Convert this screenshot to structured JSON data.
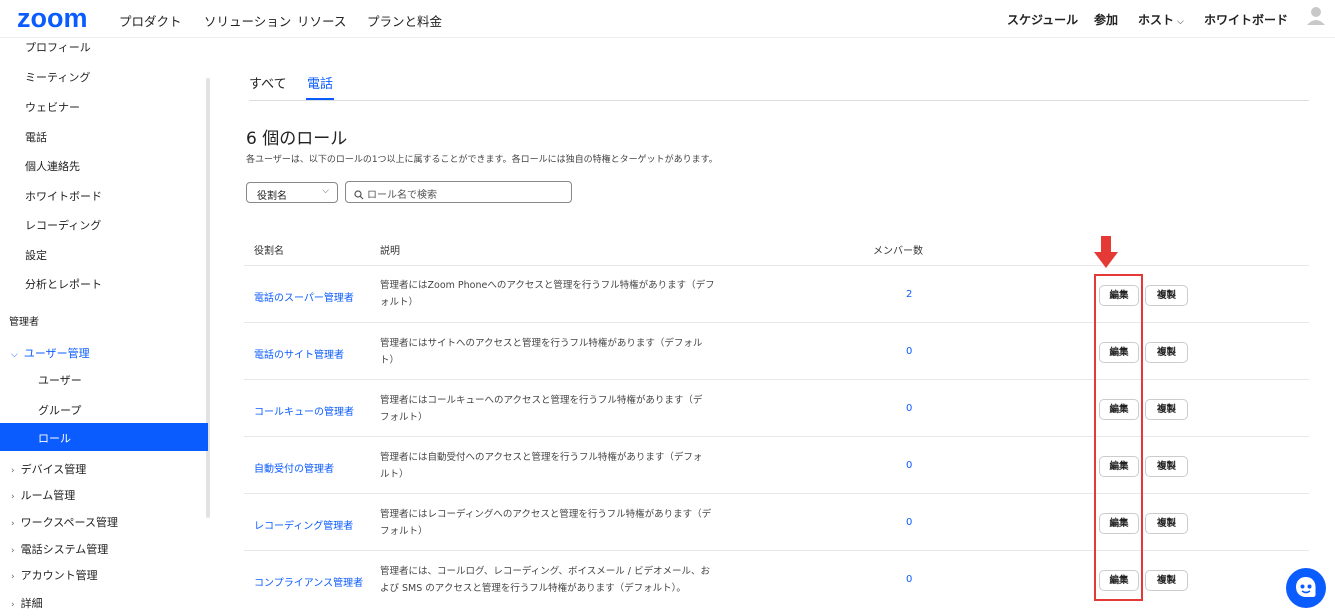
{
  "header": {
    "logo": "zoom",
    "nav": [
      "プロダクト",
      "ソリューション",
      "リソース",
      "プランと料金"
    ],
    "right": {
      "schedule": "スケジュール",
      "join": "参加",
      "host": "ホスト",
      "whiteboard": "ホワイトボード"
    }
  },
  "sidebar": {
    "items": [
      "プロフィール",
      "ミーティング",
      "ウェビナー",
      "電話",
      "個人連絡先",
      "ホワイトボード",
      "レコーディング",
      "設定",
      "分析とレポート"
    ],
    "admin_section": "管理者",
    "user_mgmt": {
      "label": "ユーザー管理",
      "children": [
        "ユーザー",
        "グループ",
        "ロール"
      ],
      "active": "ロール"
    },
    "groups": [
      "デバイス管理",
      "ルーム管理",
      "ワークスペース管理",
      "電話システム管理",
      "アカウント管理",
      "詳細"
    ]
  },
  "main": {
    "tabs": [
      {
        "label": "すべて",
        "active": false
      },
      {
        "label": "電話",
        "active": true
      }
    ],
    "title": "6 個のロール",
    "description": "各ユーザーは、以下のロールの1つ以上に属することができます。各ロールには独自の特権とターゲットがあります。",
    "filter": {
      "selected": "役割名",
      "search_placeholder": "ロール名で検索"
    },
    "columns": {
      "name": "役割名",
      "description": "説明",
      "members": "メンバー数"
    },
    "buttons": {
      "edit": "編集",
      "copy": "複製"
    },
    "roles": [
      {
        "name": "電話のスーパー管理者",
        "desc1": "管理者にはZoom Phoneへのアクセスと管理を行うフル特権があります（デフ",
        "desc2": "ォルト）",
        "members": "2"
      },
      {
        "name": "電話のサイト管理者",
        "desc1": "管理者にはサイトへのアクセスと管理を行うフル特権があります（デフォル",
        "desc2": "ト）",
        "members": "0"
      },
      {
        "name": "コールキューの管理者",
        "desc1": "管理者にはコールキューへのアクセスと管理を行うフル特権があります（デ",
        "desc2": "フォルト）",
        "members": "0"
      },
      {
        "name": "自動受付の管理者",
        "desc1": "管理者には自動受付へのアクセスと管理を行うフル特権があります（デフォ",
        "desc2": "ルト）",
        "members": "0"
      },
      {
        "name": "レコーディング管理者",
        "desc1": "管理者にはレコーディングへのアクセスと管理を行うフル特権があります（デ",
        "desc2": "フォルト）",
        "members": "0"
      },
      {
        "name": "コンプライアンス管理者",
        "desc1": "管理者には、コールログ、レコーディング、ボイスメール / ビデオメール、お",
        "desc2": "よび SMS のアクセスと管理を行うフル特権があります（デフォルト）。",
        "members": "0"
      }
    ]
  },
  "colors": {
    "accent": "#0b5cff",
    "highlight": "#e53935"
  },
  "icons": [
    "search-icon",
    "chevron-down-icon",
    "chevron-right-icon",
    "avatar-icon",
    "arrow-down-icon",
    "chat-bot-icon"
  ]
}
